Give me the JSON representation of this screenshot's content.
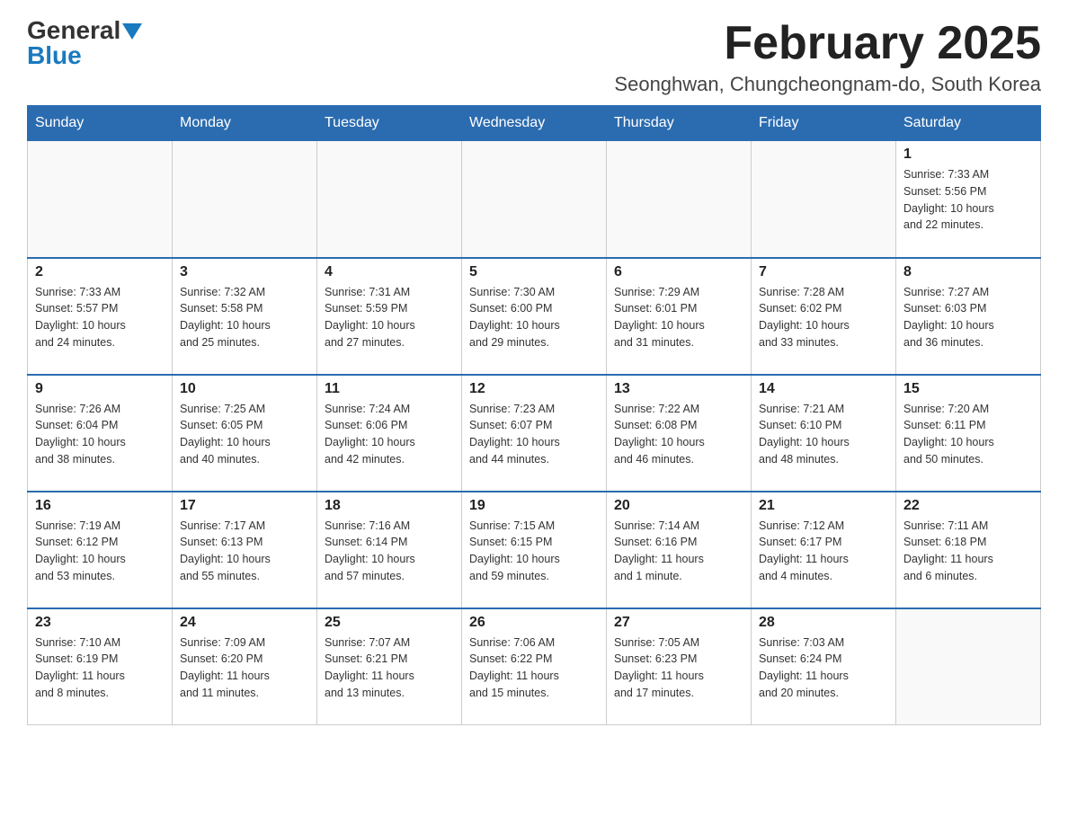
{
  "header": {
    "logo": {
      "general": "General",
      "blue": "Blue",
      "tagline": ""
    },
    "title": "February 2025",
    "location": "Seonghwan, Chungcheongnam-do, South Korea"
  },
  "days_of_week": [
    "Sunday",
    "Monday",
    "Tuesday",
    "Wednesday",
    "Thursday",
    "Friday",
    "Saturday"
  ],
  "weeks": [
    [
      {
        "day": "",
        "info": ""
      },
      {
        "day": "",
        "info": ""
      },
      {
        "day": "",
        "info": ""
      },
      {
        "day": "",
        "info": ""
      },
      {
        "day": "",
        "info": ""
      },
      {
        "day": "",
        "info": ""
      },
      {
        "day": "1",
        "info": "Sunrise: 7:33 AM\nSunset: 5:56 PM\nDaylight: 10 hours\nand 22 minutes."
      }
    ],
    [
      {
        "day": "2",
        "info": "Sunrise: 7:33 AM\nSunset: 5:57 PM\nDaylight: 10 hours\nand 24 minutes."
      },
      {
        "day": "3",
        "info": "Sunrise: 7:32 AM\nSunset: 5:58 PM\nDaylight: 10 hours\nand 25 minutes."
      },
      {
        "day": "4",
        "info": "Sunrise: 7:31 AM\nSunset: 5:59 PM\nDaylight: 10 hours\nand 27 minutes."
      },
      {
        "day": "5",
        "info": "Sunrise: 7:30 AM\nSunset: 6:00 PM\nDaylight: 10 hours\nand 29 minutes."
      },
      {
        "day": "6",
        "info": "Sunrise: 7:29 AM\nSunset: 6:01 PM\nDaylight: 10 hours\nand 31 minutes."
      },
      {
        "day": "7",
        "info": "Sunrise: 7:28 AM\nSunset: 6:02 PM\nDaylight: 10 hours\nand 33 minutes."
      },
      {
        "day": "8",
        "info": "Sunrise: 7:27 AM\nSunset: 6:03 PM\nDaylight: 10 hours\nand 36 minutes."
      }
    ],
    [
      {
        "day": "9",
        "info": "Sunrise: 7:26 AM\nSunset: 6:04 PM\nDaylight: 10 hours\nand 38 minutes."
      },
      {
        "day": "10",
        "info": "Sunrise: 7:25 AM\nSunset: 6:05 PM\nDaylight: 10 hours\nand 40 minutes."
      },
      {
        "day": "11",
        "info": "Sunrise: 7:24 AM\nSunset: 6:06 PM\nDaylight: 10 hours\nand 42 minutes."
      },
      {
        "day": "12",
        "info": "Sunrise: 7:23 AM\nSunset: 6:07 PM\nDaylight: 10 hours\nand 44 minutes."
      },
      {
        "day": "13",
        "info": "Sunrise: 7:22 AM\nSunset: 6:08 PM\nDaylight: 10 hours\nand 46 minutes."
      },
      {
        "day": "14",
        "info": "Sunrise: 7:21 AM\nSunset: 6:10 PM\nDaylight: 10 hours\nand 48 minutes."
      },
      {
        "day": "15",
        "info": "Sunrise: 7:20 AM\nSunset: 6:11 PM\nDaylight: 10 hours\nand 50 minutes."
      }
    ],
    [
      {
        "day": "16",
        "info": "Sunrise: 7:19 AM\nSunset: 6:12 PM\nDaylight: 10 hours\nand 53 minutes."
      },
      {
        "day": "17",
        "info": "Sunrise: 7:17 AM\nSunset: 6:13 PM\nDaylight: 10 hours\nand 55 minutes."
      },
      {
        "day": "18",
        "info": "Sunrise: 7:16 AM\nSunset: 6:14 PM\nDaylight: 10 hours\nand 57 minutes."
      },
      {
        "day": "19",
        "info": "Sunrise: 7:15 AM\nSunset: 6:15 PM\nDaylight: 10 hours\nand 59 minutes."
      },
      {
        "day": "20",
        "info": "Sunrise: 7:14 AM\nSunset: 6:16 PM\nDaylight: 11 hours\nand 1 minute."
      },
      {
        "day": "21",
        "info": "Sunrise: 7:12 AM\nSunset: 6:17 PM\nDaylight: 11 hours\nand 4 minutes."
      },
      {
        "day": "22",
        "info": "Sunrise: 7:11 AM\nSunset: 6:18 PM\nDaylight: 11 hours\nand 6 minutes."
      }
    ],
    [
      {
        "day": "23",
        "info": "Sunrise: 7:10 AM\nSunset: 6:19 PM\nDaylight: 11 hours\nand 8 minutes."
      },
      {
        "day": "24",
        "info": "Sunrise: 7:09 AM\nSunset: 6:20 PM\nDaylight: 11 hours\nand 11 minutes."
      },
      {
        "day": "25",
        "info": "Sunrise: 7:07 AM\nSunset: 6:21 PM\nDaylight: 11 hours\nand 13 minutes."
      },
      {
        "day": "26",
        "info": "Sunrise: 7:06 AM\nSunset: 6:22 PM\nDaylight: 11 hours\nand 15 minutes."
      },
      {
        "day": "27",
        "info": "Sunrise: 7:05 AM\nSunset: 6:23 PM\nDaylight: 11 hours\nand 17 minutes."
      },
      {
        "day": "28",
        "info": "Sunrise: 7:03 AM\nSunset: 6:24 PM\nDaylight: 11 hours\nand 20 minutes."
      },
      {
        "day": "",
        "info": ""
      }
    ]
  ]
}
